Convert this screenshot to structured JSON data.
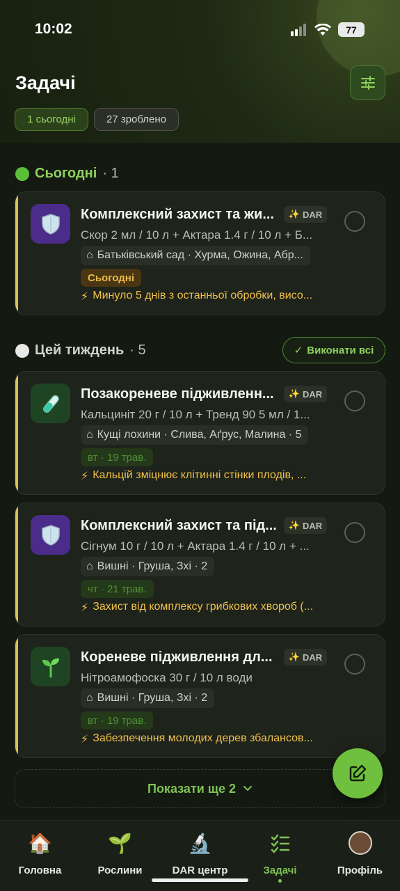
{
  "status_bar": {
    "time": "10:02",
    "battery": "77"
  },
  "header": {
    "title": "Задачі",
    "chips": {
      "today": "1 сьогодні",
      "done": "27 зроблено"
    }
  },
  "sections": {
    "today": {
      "title": "Сьогодні",
      "count": "· 1"
    },
    "week": {
      "title": "Цей тиждень",
      "count": "· 5",
      "complete_all": "Виконати всі"
    }
  },
  "tasks": [
    {
      "title": "Комплексний захист та жи...",
      "badge": "DAR",
      "recipe": "Скор 2 мл / 10 л + Актара 1.4 г / 10 л + Б...",
      "location": "Батьківський сад · Хурма, Ожина, Абр...",
      "date": "Сьогодні",
      "reason": "Минуло 5 днів з останньої обробки, висо...",
      "icon": "shield-icon"
    },
    {
      "title": "Позакореневе підживленн...",
      "badge": "DAR",
      "recipe": "Кальциніт 20 г / 10 л + Тренд 90 5 мл / 1...",
      "location": "Кущі лохини · Слива, Аґрус, Малина · 5",
      "date": "вт · 19 трав.",
      "reason": "Кальцій зміцнює клітинні стінки плодів, ...",
      "icon": "test-tube-icon"
    },
    {
      "title": "Комплексний захист та під...",
      "badge": "DAR",
      "recipe": "Сігнум 10 г / 10 л + Актара 1.4 г / 10 л + ...",
      "location": "Вишні · Груша, Зхі · 2",
      "date": "чт · 21 трав.",
      "reason": "Захист від комплексу грибкових хвороб (...",
      "icon": "shield-icon"
    },
    {
      "title": "Кореневе підживлення дл...",
      "badge": "DAR",
      "recipe": "Нітроамофоска 30 г / 10 л води",
      "location": "Вишні · Груша, Зхі · 2",
      "date": "вт · 19 трав.",
      "reason": "Забезпечення молодих дерев збалансов...",
      "icon": "seedling-icon"
    }
  ],
  "show_more": "Показати ще 2",
  "nav": [
    {
      "label": "Головна",
      "icon": "house-icon"
    },
    {
      "label": "Рослини",
      "icon": "seedling-icon"
    },
    {
      "label": "DAR центр",
      "icon": "microscope-icon"
    },
    {
      "label": "Задачі",
      "icon": "checklist-icon",
      "active": true
    },
    {
      "label": "Профіль",
      "icon": "avatar-icon"
    }
  ],
  "colors": {
    "accent_green": "#7fc256",
    "warning_yellow": "#f0c04a",
    "background": "#141a12",
    "card": "#1e231b"
  }
}
